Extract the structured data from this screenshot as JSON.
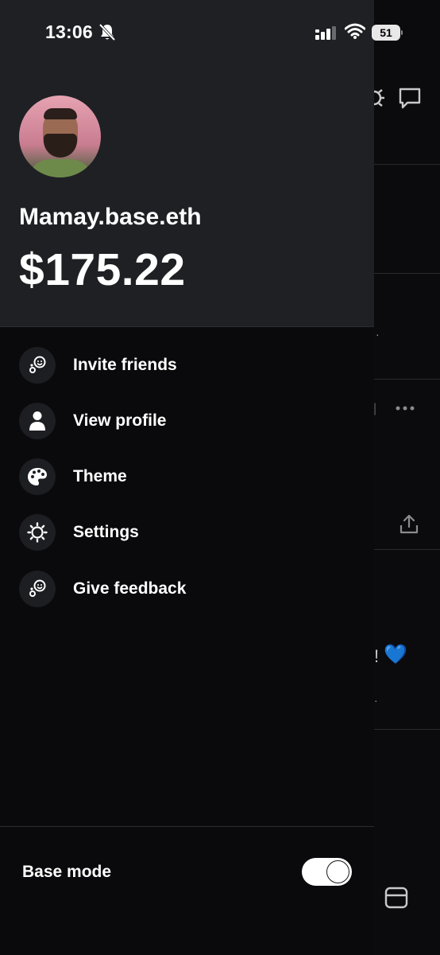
{
  "status_bar": {
    "time": "13:06",
    "battery": "51"
  },
  "profile": {
    "username": "Mamay.base.eth",
    "balance": "$175.22"
  },
  "menu": {
    "items": [
      {
        "label": "Invite friends",
        "icon": "invite-friends-icon"
      },
      {
        "label": "View profile",
        "icon": "person-icon"
      },
      {
        "label": "Theme",
        "icon": "palette-icon"
      },
      {
        "label": "Settings",
        "icon": "gear-icon"
      },
      {
        "label": "Give feedback",
        "icon": "feedback-icon"
      }
    ]
  },
  "footer": {
    "base_mode_label": "Base mode",
    "base_mode_enabled": true
  },
  "background": {
    "heart": "💙",
    "exclaim": "!"
  },
  "colors": {
    "drawer_header_bg": "#1f2024",
    "drawer_bg": "#0a0a0c",
    "heart_blue": "#2e4fa8"
  }
}
